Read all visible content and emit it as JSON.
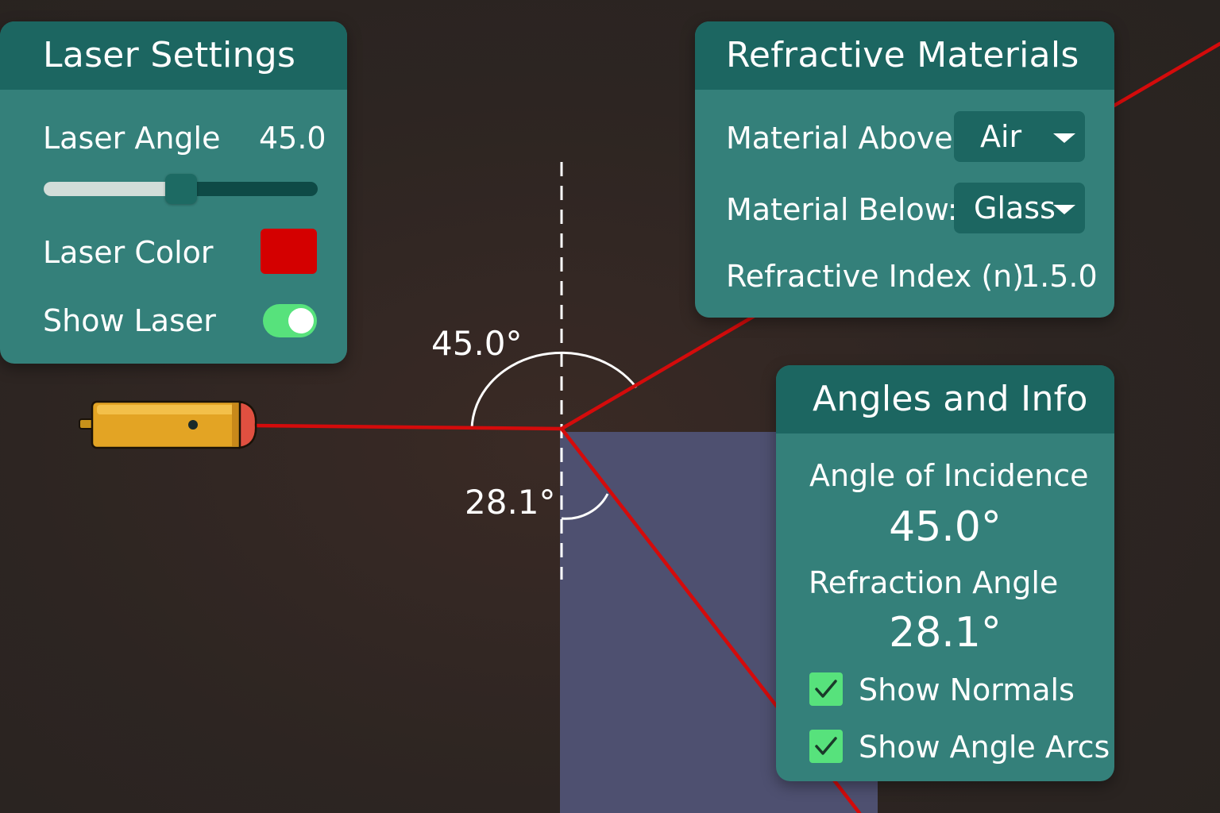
{
  "laser_settings": {
    "title": "Laser Settings",
    "angle_label": "Laser Angle",
    "angle_value": "45.0",
    "slider_fraction": 0.5,
    "color_label": "Laser Color",
    "color_hex": "#d40000",
    "show_label": "Show Laser",
    "show_on": true
  },
  "materials": {
    "title": "Refractive Materials",
    "above_label": "Material Above:",
    "above_value": "Air",
    "below_label": "Material Below:",
    "below_value": "Glass",
    "index_label": "Refractive Index (n)",
    "index_value": "1.5.0"
  },
  "info": {
    "title": "Angles and Info",
    "incidence_label": "Angle of Incidence",
    "incidence_value": "45.0°",
    "refraction_label": "Refraction Angle",
    "refraction_value": "28.1°",
    "normals_label": "Show Normals",
    "normals_checked": true,
    "arcs_label": "Show Angle Arcs",
    "arcs_checked": true
  },
  "scene": {
    "incidence_arc_label": "45.0°",
    "refraction_arc_label": "28.1°",
    "laser_color": "#d40b0b",
    "glass_color": "#4e5070"
  }
}
